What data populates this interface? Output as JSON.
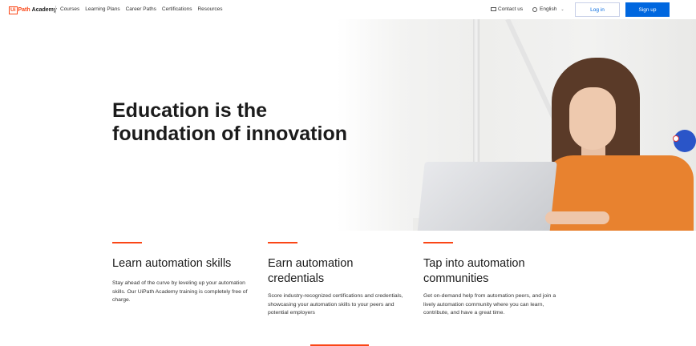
{
  "brand": {
    "logo_box": "Ui",
    "logo_path": "Path",
    "logo_academy": "Academy",
    "accent_color": "#fa4616"
  },
  "nav": {
    "items": [
      "Courses",
      "Learning Plans",
      "Career Paths",
      "Certifications",
      "Resources"
    ]
  },
  "header_right": {
    "contact_label": "Contact us",
    "language_label": "English",
    "login_label": "Log in",
    "signup_label": "Sign up",
    "primary_color": "#0067df"
  },
  "hero": {
    "title_line1": "Education is the",
    "title_line2": "foundation of innovation"
  },
  "features": [
    {
      "title": "Learn automation skills",
      "text": "Stay ahead of the curve by leveling up your automation skills. Our UiPath Academy training is completely free of charge."
    },
    {
      "title": "Earn automation credentials",
      "text": "Score industry-recognized certifications and credentials, showcasing your automation skills to your peers and potential employers"
    },
    {
      "title": "Tap into automation communities",
      "text": "Get on-demand help from automation peers, and join a lively automation community where you can learn, contribute, and have a great time."
    }
  ]
}
